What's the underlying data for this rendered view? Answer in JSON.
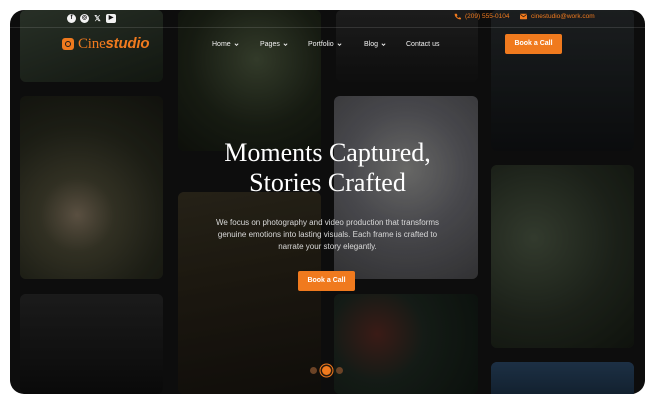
{
  "social": [
    {
      "name": "facebook-icon",
      "glyph": "f"
    },
    {
      "name": "instagram-icon",
      "glyph": "◎"
    },
    {
      "name": "x-icon",
      "glyph": "𝕏"
    },
    {
      "name": "youtube-icon",
      "glyph": "▶"
    }
  ],
  "contact": {
    "phone": "(209) 555-0104",
    "email": "cinestudio@work.com"
  },
  "logo": {
    "part1": "Cine",
    "part2": "studio"
  },
  "nav": {
    "home": "Home",
    "pages": "Pages",
    "portfolio": "Portfolio",
    "blog": "Blog",
    "contact": "Contact us"
  },
  "header_cta": "Book a Call",
  "hero": {
    "title_line1": "Moments Captured,",
    "title_line2": "Stories Crafted",
    "subtitle": "We focus on photography and video production that transforms genuine emotions into lasting visuals. Each frame is crafted to narrate your story elegantly.",
    "cta": "Book a Call"
  },
  "colors": {
    "accent": "#f07a1e",
    "background": "#0d0d0d"
  },
  "slider": {
    "count": 3,
    "active_index": 1
  }
}
